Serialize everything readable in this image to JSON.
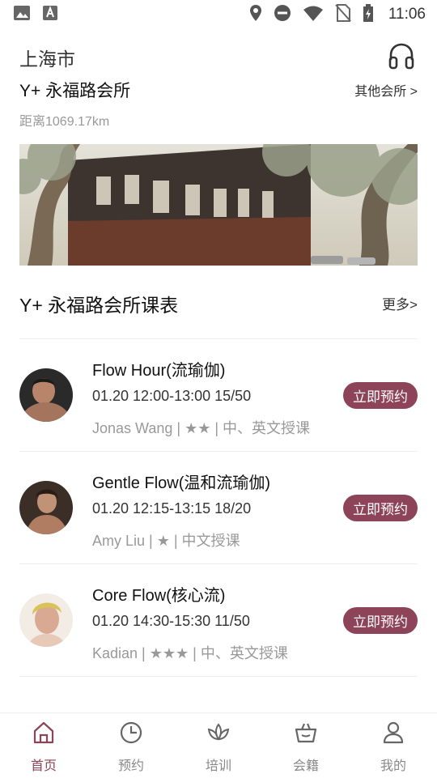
{
  "status_bar": {
    "time": "11:06",
    "icons": [
      "image-icon",
      "a-icon",
      "location-icon",
      "dnd-icon",
      "wifi-icon",
      "no-sim-icon",
      "battery-icon"
    ]
  },
  "header": {
    "city": "上海市",
    "headset_icon": "headset-icon",
    "club_name": "Y+ 永福路会所",
    "other_clubs": "其他会所 >",
    "distance": "距离1069.17km"
  },
  "schedule": {
    "title": "Y+ 永福路会所课表",
    "more": "更多>",
    "classes": [
      {
        "title": "Flow Hour(流瑜伽)",
        "time": "01.20 12:00-13:00   15/50",
        "teacher": "Jonas Wang  | ★★ | 中、英文授课",
        "button": "立即预约"
      },
      {
        "title": "Gentle Flow(温和流瑜伽)",
        "time": "01.20 12:15-13:15   18/20",
        "teacher": "Amy Liu  | ★ | 中文授课",
        "button": "立即预约"
      },
      {
        "title": "Core Flow(核心流)",
        "time": "01.20 14:30-15:30   11/50",
        "teacher": "Kadian  | ★★★ | 中、英文授课",
        "button": "立即预约"
      }
    ]
  },
  "tabs": [
    {
      "label": "首页",
      "icon": "home-icon",
      "active": true
    },
    {
      "label": "预约",
      "icon": "clock-icon",
      "active": false
    },
    {
      "label": "培训",
      "icon": "lotus-icon",
      "active": false
    },
    {
      "label": "会籍",
      "icon": "basket-icon",
      "active": false
    },
    {
      "label": "我的",
      "icon": "person-icon",
      "active": false
    }
  ],
  "colors": {
    "accent": "#8d4358",
    "text_primary": "#111111",
    "text_secondary": "#999999"
  }
}
